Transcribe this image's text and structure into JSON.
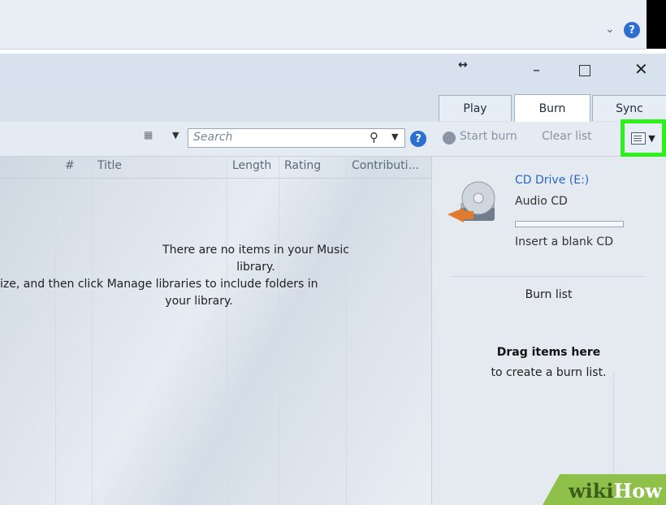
{
  "window": {
    "controls": {
      "resize": "↔",
      "minimize": "–",
      "close": "✕"
    }
  },
  "tabs": [
    {
      "label": "Play"
    },
    {
      "label": "Burn",
      "active": true
    },
    {
      "label": "Sync"
    }
  ],
  "toolbar": {
    "search_placeholder": "Search",
    "start_burn": "Start burn",
    "clear_list": "Clear list"
  },
  "library": {
    "columns": [
      "#",
      "Title",
      "Length",
      "Rating",
      "Contributi..."
    ],
    "empty_message_lines": [
      "There are no items in your Music library.",
      "ize, and then click Manage libraries to include folders in",
      "your library."
    ]
  },
  "burn_panel": {
    "drive": "CD Drive (E:)",
    "media_type": "Audio CD",
    "status": "Insert a blank CD",
    "list_title": "Burn list",
    "drag_title": "Drag items here",
    "drag_subtitle": "to create a burn list."
  },
  "watermark": {
    "part1": "wiki",
    "part2": "How"
  },
  "colors": {
    "highlight": "#2ff018",
    "link": "#2a67c9",
    "help": "#2b6fd1"
  },
  "icons": [
    "chevron-down-icon",
    "help-icon",
    "view-options-icon",
    "search-icon",
    "start-burn-icon",
    "list-options-icon",
    "cd-drive-icon"
  ]
}
